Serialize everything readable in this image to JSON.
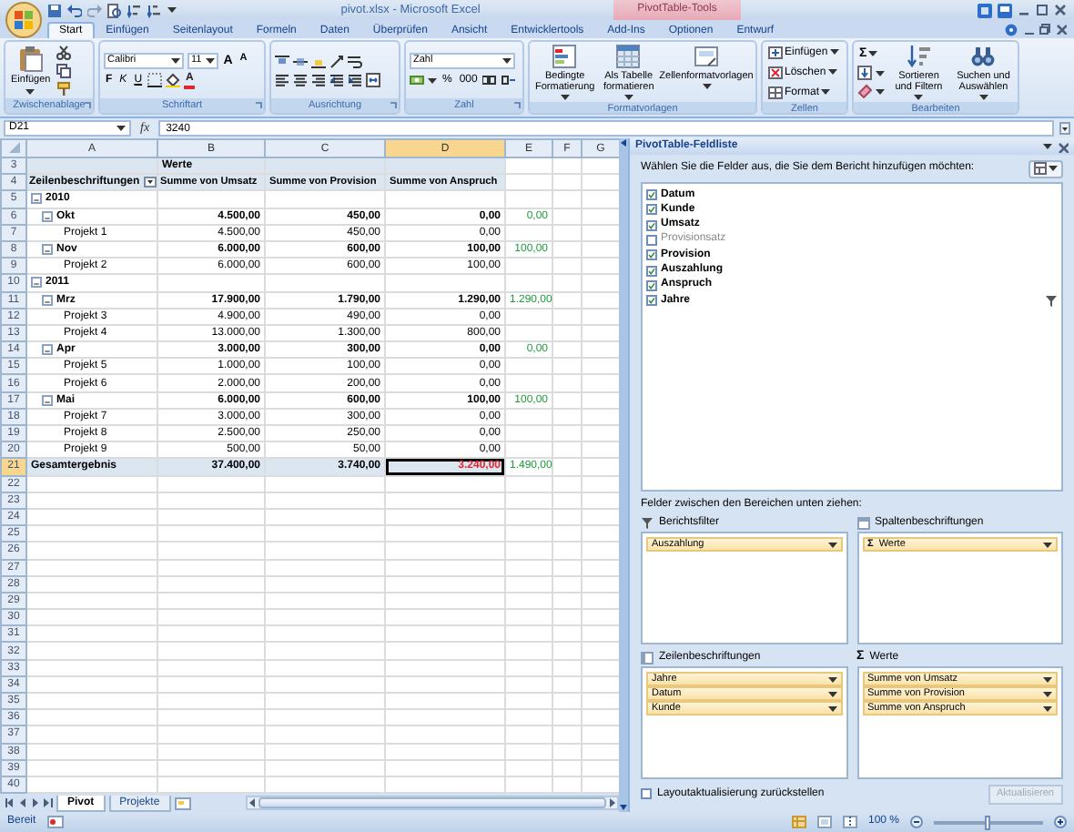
{
  "window": {
    "title": "pivot.xlsx - Microsoft Excel",
    "context_tab": "PivotTable-Tools"
  },
  "ribbon": {
    "tabs": [
      {
        "label": "Start",
        "selected": true
      },
      {
        "label": "Einfügen",
        "selected": false
      },
      {
        "label": "Seitenlayout",
        "selected": false
      },
      {
        "label": "Formeln",
        "selected": false
      },
      {
        "label": "Daten",
        "selected": false
      },
      {
        "label": "Überprüfen",
        "selected": false
      },
      {
        "label": "Ansicht",
        "selected": false
      },
      {
        "label": "Entwicklertools",
        "selected": false
      },
      {
        "label": "Add-Ins",
        "selected": false
      },
      {
        "label": "Optionen",
        "selected": false
      },
      {
        "label": "Entwurf",
        "selected": false
      }
    ],
    "clipboard": {
      "label": "Zwischenablage",
      "paste": "Einfügen"
    },
    "font": {
      "label": "Schriftart",
      "name": "Calibri",
      "size": "11",
      "grow": "A",
      "shrink": "A",
      "bold": "F",
      "italic": "K",
      "underline": "U",
      "color_button": "A"
    },
    "alignment": {
      "label": "Ausrichtung"
    },
    "number": {
      "label": "Zahl",
      "format": "Zahl",
      "percent": "%",
      "thousands": "000"
    },
    "styles": {
      "label": "Formatvorlagen",
      "buttons": [
        "Bedingte Formatierung",
        "Als Tabelle formatieren",
        "Zellenformatvorlagen"
      ]
    },
    "cells": {
      "label": "Zellen",
      "buttons": [
        "Einfügen",
        "Löschen",
        "Format"
      ]
    },
    "editing": {
      "label": "Bearbeiten",
      "sigma": "Σ",
      "buttons": [
        "Sortieren und Filtern",
        "Suchen und Auswählen"
      ]
    }
  },
  "formula_bar": {
    "name_box": "D21",
    "fx": "fx",
    "value": "3240"
  },
  "sheet": {
    "columns": [
      {
        "label": "A",
        "selected": false
      },
      {
        "label": "B",
        "selected": false
      },
      {
        "label": "C",
        "selected": false
      },
      {
        "label": "D",
        "selected": true
      },
      {
        "label": "E",
        "selected": false
      },
      {
        "label": "F",
        "selected": false
      },
      {
        "label": "G",
        "selected": false
      }
    ],
    "rows": [
      {
        "num": "3",
        "kind": "caption",
        "selected": false,
        "caption": "Werte"
      },
      {
        "num": "4",
        "kind": "header",
        "selected": false,
        "label": "Zeilenbeschriftungen",
        "values": [
          "Summe von Umsatz",
          "Summe von Provision",
          "Summe von Anspruch"
        ]
      },
      {
        "num": "5",
        "kind": "year",
        "selected": false,
        "expanded": true,
        "label": "2010"
      },
      {
        "num": "6",
        "kind": "month",
        "selected": false,
        "expanded": true,
        "label": "Okt",
        "values": [
          "4.500,00",
          "450,00",
          "0,00"
        ],
        "column_e": "0,00"
      },
      {
        "num": "7",
        "kind": "item",
        "selected": false,
        "label": "Projekt 1",
        "values": [
          "4.500,00",
          "450,00",
          "0,00"
        ]
      },
      {
        "num": "8",
        "kind": "month",
        "selected": false,
        "expanded": true,
        "label": "Nov",
        "values": [
          "6.000,00",
          "600,00",
          "100,00"
        ],
        "column_e": "100,00"
      },
      {
        "num": "9",
        "kind": "item",
        "selected": false,
        "label": "Projekt 2",
        "values": [
          "6.000,00",
          "600,00",
          "100,00"
        ]
      },
      {
        "num": "10",
        "kind": "year",
        "selected": false,
        "expanded": true,
        "label": "2011"
      },
      {
        "num": "11",
        "kind": "month",
        "selected": false,
        "expanded": true,
        "label": "Mrz",
        "values": [
          "17.900,00",
          "1.790,00",
          "1.290,00"
        ],
        "column_e": "1.290,00"
      },
      {
        "num": "12",
        "kind": "item",
        "selected": false,
        "label": "Projekt 3",
        "values": [
          "4.900,00",
          "490,00",
          "0,00"
        ]
      },
      {
        "num": "13",
        "kind": "item",
        "selected": false,
        "label": "Projekt 4",
        "values": [
          "13.000,00",
          "1.300,00",
          "800,00"
        ]
      },
      {
        "num": "14",
        "kind": "month",
        "selected": false,
        "expanded": true,
        "label": "Apr",
        "values": [
          "3.000,00",
          "300,00",
          "0,00"
        ],
        "column_e": "0,00"
      },
      {
        "num": "15",
        "kind": "item",
        "selected": false,
        "label": "Projekt 5",
        "values": [
          "1.000,00",
          "100,00",
          "0,00"
        ]
      },
      {
        "num": "16",
        "kind": "item",
        "selected": false,
        "label": "Projekt 6",
        "values": [
          "2.000,00",
          "200,00",
          "0,00"
        ]
      },
      {
        "num": "17",
        "kind": "month",
        "selected": false,
        "expanded": true,
        "label": "Mai",
        "values": [
          "6.000,00",
          "600,00",
          "100,00"
        ],
        "column_e": "100,00"
      },
      {
        "num": "18",
        "kind": "item",
        "selected": false,
        "label": "Projekt 7",
        "values": [
          "3.000,00",
          "300,00",
          "0,00"
        ]
      },
      {
        "num": "19",
        "kind": "item",
        "selected": false,
        "label": "Projekt 8",
        "values": [
          "2.500,00",
          "250,00",
          "0,00"
        ]
      },
      {
        "num": "20",
        "kind": "item",
        "selected": false,
        "label": "Projekt 9",
        "values": [
          "500,00",
          "50,00",
          "0,00"
        ]
      },
      {
        "num": "21",
        "kind": "total",
        "selected": true,
        "flagged": true,
        "label": "Gesamtergebnis",
        "values": [
          "37.400,00",
          "3.740,00",
          "3.240,00"
        ],
        "column_e": "1.490,00"
      },
      {
        "num": "22",
        "kind": "blank",
        "selected": false
      },
      {
        "num": "23",
        "kind": "blank",
        "selected": false
      },
      {
        "num": "24",
        "kind": "blank",
        "selected": false
      },
      {
        "num": "25",
        "kind": "blank",
        "selected": false
      },
      {
        "num": "26",
        "kind": "blank",
        "selected": false
      },
      {
        "num": "27",
        "kind": "blank",
        "selected": false
      },
      {
        "num": "28",
        "kind": "blank",
        "selected": false
      },
      {
        "num": "29",
        "kind": "blank",
        "selected": false
      },
      {
        "num": "30",
        "kind": "blank",
        "selected": false
      },
      {
        "num": "31",
        "kind": "blank",
        "selected": false
      },
      {
        "num": "32",
        "kind": "blank",
        "selected": false
      },
      {
        "num": "33",
        "kind": "blank",
        "selected": false
      },
      {
        "num": "34",
        "kind": "blank",
        "selected": false
      },
      {
        "num": "35",
        "kind": "blank",
        "selected": false
      },
      {
        "num": "36",
        "kind": "blank",
        "selected": false
      },
      {
        "num": "37",
        "kind": "blank",
        "selected": false
      },
      {
        "num": "38",
        "kind": "blank",
        "selected": false
      },
      {
        "num": "39",
        "kind": "blank",
        "selected": false
      },
      {
        "num": "40",
        "kind": "blank",
        "selected": false
      }
    ],
    "tabs": [
      {
        "label": "Pivot",
        "selected": true
      },
      {
        "label": "Projekte",
        "selected": false
      }
    ]
  },
  "field_list": {
    "title": "PivotTable-Feldliste",
    "prompt": "Wählen Sie die Felder aus, die Sie dem Bericht hinzufügen möchten:",
    "fields": [
      {
        "label": "Datum",
        "checked": true,
        "filtered": false
      },
      {
        "label": "Kunde",
        "checked": true,
        "filtered": false
      },
      {
        "label": "Umsatz",
        "checked": true,
        "filtered": false
      },
      {
        "label": "Provisionsatz",
        "checked": false,
        "filtered": false
      },
      {
        "label": "Provision",
        "checked": true,
        "filtered": false
      },
      {
        "label": "Auszahlung",
        "checked": true,
        "filtered": false
      },
      {
        "label": "Anspruch",
        "checked": true,
        "filtered": false
      },
      {
        "label": "Jahre",
        "checked": true,
        "filtered": true
      }
    ],
    "drag_prompt": "Felder zwischen den Bereichen unten ziehen:",
    "areas": [
      {
        "title": "Berichtsfilter",
        "items": [
          {
            "label": "Auszahlung"
          }
        ]
      },
      {
        "title": "Spaltenbeschriftungen",
        "items": [
          {
            "label": "Werte",
            "symbol": "Σ"
          }
        ]
      },
      {
        "title": "Zeilenbeschriftungen",
        "items": [
          {
            "label": "Jahre"
          },
          {
            "label": "Datum"
          },
          {
            "label": "Kunde"
          }
        ]
      },
      {
        "title": "Werte",
        "symbol": "Σ",
        "items": [
          {
            "label": "Summe von Umsatz"
          },
          {
            "label": "Summe von Provision"
          },
          {
            "label": "Summe von Anspruch"
          }
        ]
      }
    ],
    "defer": {
      "label": "Layoutaktualisierung zurückstellen",
      "checked": false
    },
    "update": {
      "label": "Aktualisieren",
      "disabled": true
    }
  },
  "status_bar": {
    "text": "Bereit",
    "zoom": "100 %",
    "level": 0.5
  }
}
